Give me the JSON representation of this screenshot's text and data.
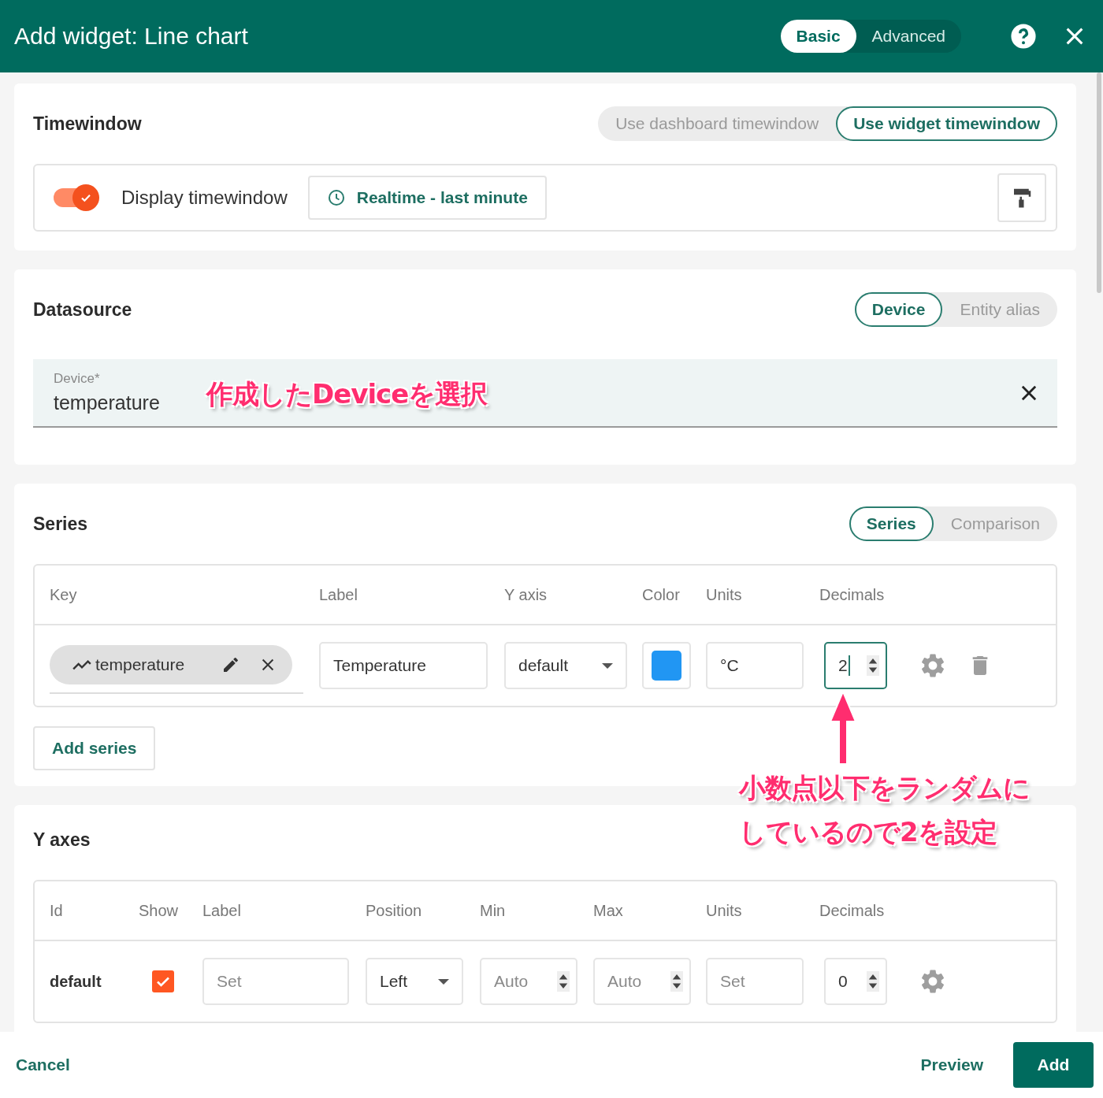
{
  "header": {
    "title": "Add widget: Line chart",
    "modes": [
      {
        "label": "Basic",
        "selected": true
      },
      {
        "label": "Advanced",
        "selected": false
      }
    ]
  },
  "timewindow": {
    "title": "Timewindow",
    "modes": [
      {
        "label": "Use dashboard timewindow",
        "selected": false
      },
      {
        "label": "Use widget timewindow",
        "selected": true
      }
    ],
    "display": {
      "label": "Display timewindow",
      "on": true
    },
    "interval": "Realtime - last minute"
  },
  "datasource": {
    "title": "Datasource",
    "types": [
      {
        "label": "Device",
        "selected": true
      },
      {
        "label": "Entity alias",
        "selected": false
      }
    ],
    "device_field": {
      "label": "Device*",
      "value": "temperature"
    }
  },
  "series": {
    "title": "Series",
    "tabs": [
      {
        "label": "Series",
        "selected": true
      },
      {
        "label": "Comparison",
        "selected": false
      }
    ],
    "columns": [
      "Key",
      "Label",
      "Y axis",
      "Color",
      "Units",
      "Decimals"
    ],
    "rows": [
      {
        "key": "temperature",
        "label": "Temperature",
        "y_axis": "default",
        "color": "#2196f3",
        "units": "°C",
        "decimals": "2",
        "focused": true
      }
    ],
    "add_button": "Add series"
  },
  "y_axes": {
    "title": "Y axes",
    "columns": [
      "Id",
      "Show",
      "Label",
      "Position",
      "Min",
      "Max",
      "Units",
      "Decimals"
    ],
    "rows": [
      {
        "id": "default",
        "show": true,
        "label_placeholder": "Set",
        "position": "Left",
        "min_placeholder": "Auto",
        "max_placeholder": "Auto",
        "units_placeholder": "Set",
        "decimals": "0"
      }
    ]
  },
  "footer": {
    "cancel": "Cancel",
    "preview": "Preview",
    "add": "Add"
  },
  "annotations": [
    {
      "kind": "callout",
      "lines": [
        "作成したDeviceを選択"
      ]
    },
    {
      "kind": "arrow-callout",
      "lines": [
        "小数点以下をランダムに",
        "しているので2を設定"
      ]
    }
  ]
}
